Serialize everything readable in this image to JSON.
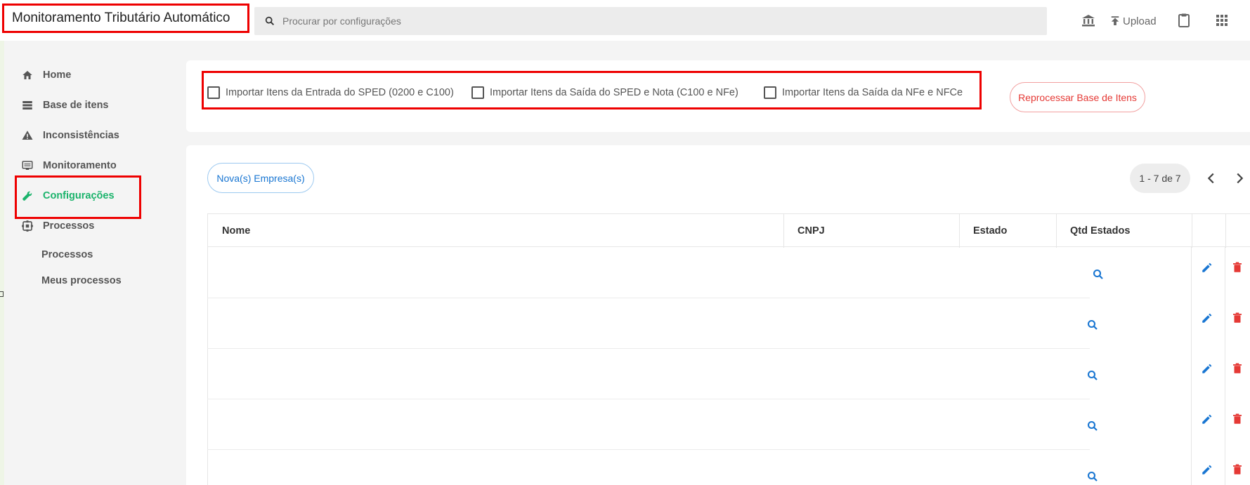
{
  "app": {
    "title": "Monitoramento Tributário Automático"
  },
  "search": {
    "placeholder": "Procurar por configurações"
  },
  "toolbar": {
    "upload_label": "Upload"
  },
  "sidebar": {
    "items": [
      {
        "label": "Home",
        "icon": "home-icon"
      },
      {
        "label": "Base de itens",
        "icon": "list-icon"
      },
      {
        "label": "Inconsistências",
        "icon": "warning-icon"
      },
      {
        "label": "Monitoramento",
        "icon": "monitor-icon"
      },
      {
        "label": "Configurações",
        "icon": "wrench-icon",
        "active": true
      },
      {
        "label": "Processos",
        "icon": "process-icon"
      }
    ],
    "subitems": [
      {
        "label": "Processos"
      },
      {
        "label": "Meus processos"
      }
    ]
  },
  "options": {
    "checkboxes": [
      {
        "label": "Importar Itens da Entrada do SPED (0200 e C100)",
        "checked": false
      },
      {
        "label": "Importar Itens da Saída do SPED e Nota (C100 e NFe)",
        "checked": false
      },
      {
        "label": "Importar Itens da Saída da NFe e NFCe",
        "checked": false
      }
    ],
    "reprocess_label": "Reprocessar Base de Itens"
  },
  "companies": {
    "new_button_label": "Nova(s) Empresa(s)",
    "pagination": "1 - 7 de 7",
    "columns": [
      "Nome",
      "CNPJ",
      "Estado",
      "Qtd Estados"
    ],
    "rows": [
      {
        "nome": "",
        "cnpj": "",
        "estado": ""
      },
      {
        "nome": "",
        "cnpj": "",
        "estado": ""
      },
      {
        "nome": "",
        "cnpj": "",
        "estado": ""
      },
      {
        "nome": "",
        "cnpj": "",
        "estado": ""
      },
      {
        "nome": "",
        "cnpj": "",
        "estado": ""
      }
    ]
  },
  "colors": {
    "accent": "#1ab36b",
    "danger": "#e53935",
    "primary": "#1976d2",
    "highlight": "#ee0000"
  }
}
